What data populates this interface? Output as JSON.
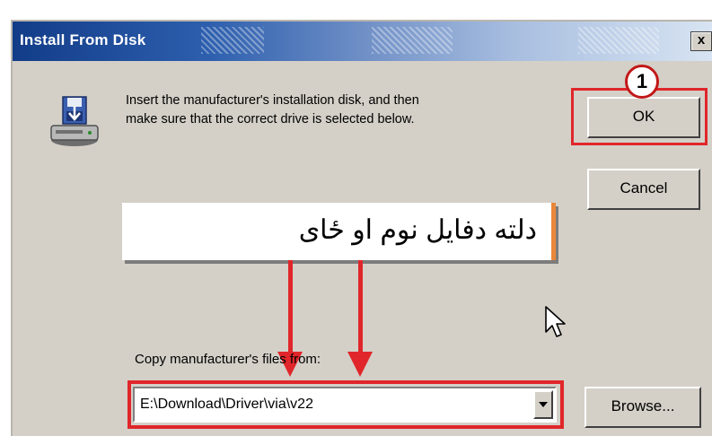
{
  "window": {
    "title": "Install From Disk",
    "close_label": "x"
  },
  "message": {
    "line1": "Insert the manufacturer's installation disk, and then",
    "line2": "make sure that the correct drive is selected below."
  },
  "buttons": {
    "ok": "OK",
    "cancel": "Cancel",
    "browse": "Browse..."
  },
  "annotation": {
    "step_number": "1",
    "banner_text": "دلته دفایل نوم او ځای"
  },
  "copy_from": {
    "label": "Copy manufacturer's files from:",
    "value": "E:\\Download\\Driver\\via\\v22"
  },
  "icons": {
    "disk": "install-disk-icon",
    "cursor": "mouse-pointer-icon",
    "dropdown": "chevron-down-icon"
  },
  "colors": {
    "highlight": "#e0262a",
    "dialog_bg": "#d4d0c8",
    "title_start": "#123c88",
    "title_end": "#d8e4f2"
  }
}
